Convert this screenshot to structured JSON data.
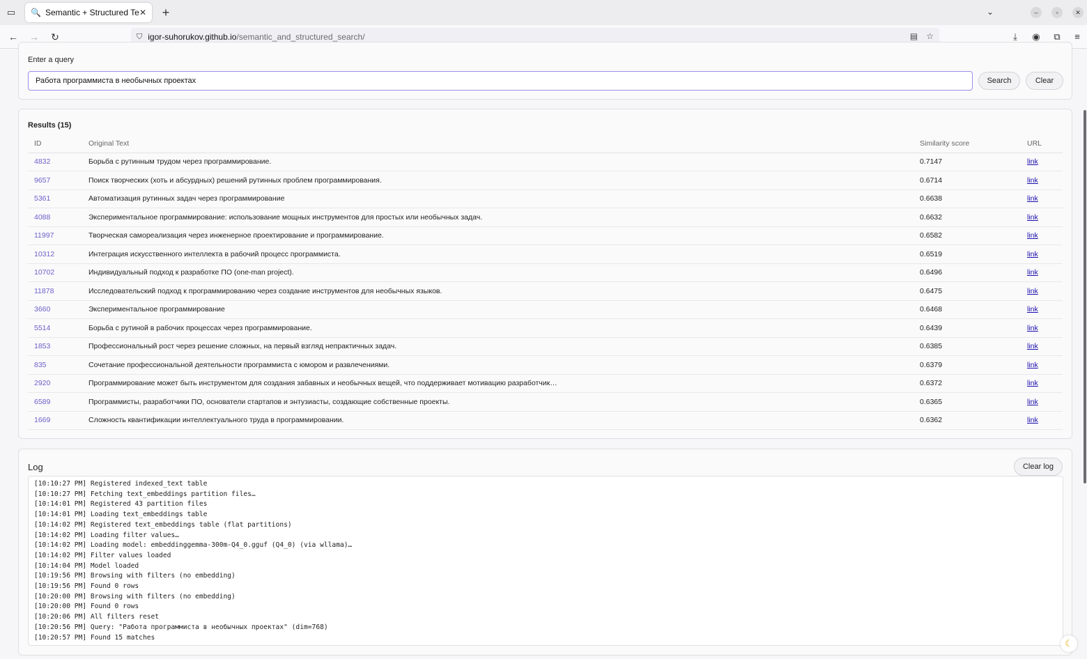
{
  "browser": {
    "tab_title": "Semantic + Structured Te",
    "url_host": "igor-suhorukov.github.io",
    "url_path": "/semantic_and_structured_search/"
  },
  "query": {
    "label": "Enter a query",
    "value": "Работа программиста в необычных проектах",
    "search_label": "Search",
    "clear_label": "Clear"
  },
  "results": {
    "title": "Results (15)",
    "columns": [
      "ID",
      "Original Text",
      "Similarity score",
      "URL"
    ],
    "rows": [
      {
        "id": "4832",
        "text": "Борьба с рутинным трудом через программирование.",
        "score": "0.7147",
        "link": "link"
      },
      {
        "id": "9657",
        "text": "Поиск творческих (хоть и абсурдных) решений рутинных проблем программирования.",
        "score": "0.6714",
        "link": "link"
      },
      {
        "id": "5361",
        "text": "Автоматизация рутинных задач через программирование",
        "score": "0.6638",
        "link": "link"
      },
      {
        "id": "4088",
        "text": "Экспериментальное программирование: использование мощных инструментов для простых или необычных задач.",
        "score": "0.6632",
        "link": "link"
      },
      {
        "id": "11997",
        "text": "Творческая самореализация через инженерное проектирование и программирование.",
        "score": "0.6582",
        "link": "link"
      },
      {
        "id": "10312",
        "text": "Интеграция искусственного интеллекта в рабочий процесс программиста.",
        "score": "0.6519",
        "link": "link"
      },
      {
        "id": "10702",
        "text": "Индивидуальный подход к разработке ПО (one-man project).",
        "score": "0.6496",
        "link": "link"
      },
      {
        "id": "11878",
        "text": "Исследовательский подход к программированию через создание инструментов для необычных языков.",
        "score": "0.6475",
        "link": "link"
      },
      {
        "id": "3660",
        "text": "Экспериментальное программирование",
        "score": "0.6468",
        "link": "link"
      },
      {
        "id": "5514",
        "text": "Борьба с рутиной в рабочих процессах через программирование.",
        "score": "0.6439",
        "link": "link"
      },
      {
        "id": "1853",
        "text": "Профессиональный рост через решение сложных, на первый взгляд непрактичных задач.",
        "score": "0.6385",
        "link": "link"
      },
      {
        "id": "835",
        "text": "Сочетание профессиональной деятельности программиста с юмором и развлечениями.",
        "score": "0.6379",
        "link": "link"
      },
      {
        "id": "2920",
        "text": "Программирование может быть инструментом для создания забавных и необычных вещей, что поддерживает мотивацию разработчик…",
        "score": "0.6372",
        "link": "link"
      },
      {
        "id": "6589",
        "text": "Программисты, разработчики ПО, основатели стартапов и энтузиасты, создающие собственные проекты.",
        "score": "0.6365",
        "link": "link"
      },
      {
        "id": "1669",
        "text": "Сложность квантификации интеллектуального труда в программировании.",
        "score": "0.6362",
        "link": "link"
      }
    ]
  },
  "log": {
    "title": "Log",
    "clear_label": "Clear log",
    "lines": [
      "[10:10:27 PM] Registered indexed_text table",
      "[10:10:27 PM] Fetching text_embeddings partition files…",
      "[10:14:01 PM] Registered 43 partition files",
      "[10:14:01 PM] Loading text_embeddings table",
      "[10:14:02 PM] Registered text_embeddings table (flat partitions)",
      "[10:14:02 PM] Loading filter values…",
      "[10:14:02 PM] Loading model: embeddinggemma-300m-Q4_0.gguf (Q4_0) (via wllama)…",
      "[10:14:02 PM] Filter values loaded",
      "[10:14:04 PM] Model loaded",
      "[10:19:56 PM] Browsing with filters (no embedding)",
      "[10:19:56 PM] Found 0 rows",
      "[10:20:00 PM] Browsing with filters (no embedding)",
      "[10:20:00 PM] Found 0 rows",
      "[10:20:06 PM] All filters reset",
      "[10:20:56 PM] Query: \"Работа программиста в необычных проектах\" (dim=768)",
      "[10:20:57 PM] Found 15 matches"
    ]
  }
}
